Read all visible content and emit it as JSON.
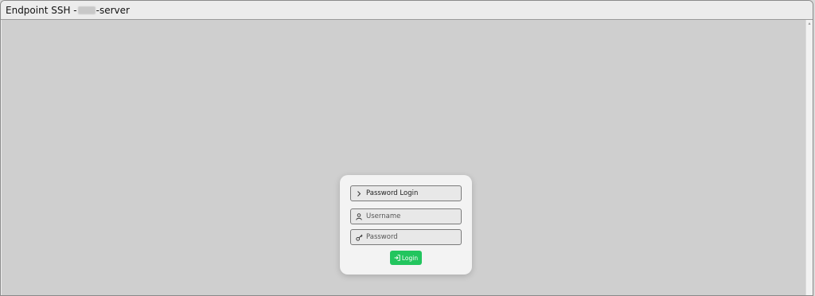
{
  "window": {
    "title_prefix": "Endpoint SSH - ",
    "title_suffix": "-server"
  },
  "login": {
    "section_label": "Password Login",
    "username_placeholder": "Username",
    "password_placeholder": "Password",
    "submit_label": "Login",
    "accent_color": "#22c55e"
  },
  "icons": {
    "section": "chevron-right-icon",
    "username": "user-icon",
    "password": "key-icon",
    "submit": "login-icon"
  }
}
